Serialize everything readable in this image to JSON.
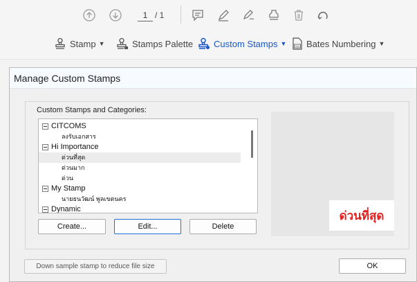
{
  "toolbar_top": {
    "page_current": "1",
    "page_total": "/ 1"
  },
  "toolbar_stamps": {
    "stamp_label": "Stamp",
    "palette_label": "Stamps Palette",
    "custom_label": "Custom Stamps",
    "bates_label": "Bates Numbering",
    "accent_color": "#1a56c4"
  },
  "dialog": {
    "title": "Manage Custom Stamps",
    "group_label": "Custom Stamps and Categories:",
    "tree": [
      {
        "label": "CITCOMS",
        "level": "parent"
      },
      {
        "label": "ลงรับเอกสาร",
        "level": "child"
      },
      {
        "label": "Hi Importance",
        "level": "parent"
      },
      {
        "label": "ด่วนที่สุด",
        "level": "child",
        "selected": true
      },
      {
        "label": "ด่วนมาก",
        "level": "child"
      },
      {
        "label": "ด่วน",
        "level": "child"
      },
      {
        "label": "My Stamp",
        "level": "parent"
      },
      {
        "label": "นายธนวัฒน์ พูลเขตนคร",
        "level": "child"
      },
      {
        "label": "Dynamic",
        "level": "parent"
      }
    ],
    "create_label": "Create...",
    "edit_label": "Edit...",
    "delete_label": "Delete",
    "preview_text": "ด่วนที่สุด",
    "preview_color": "#e21f1f",
    "downsample_label": "Down sample stamp to reduce file size",
    "ok_label": "OK"
  }
}
